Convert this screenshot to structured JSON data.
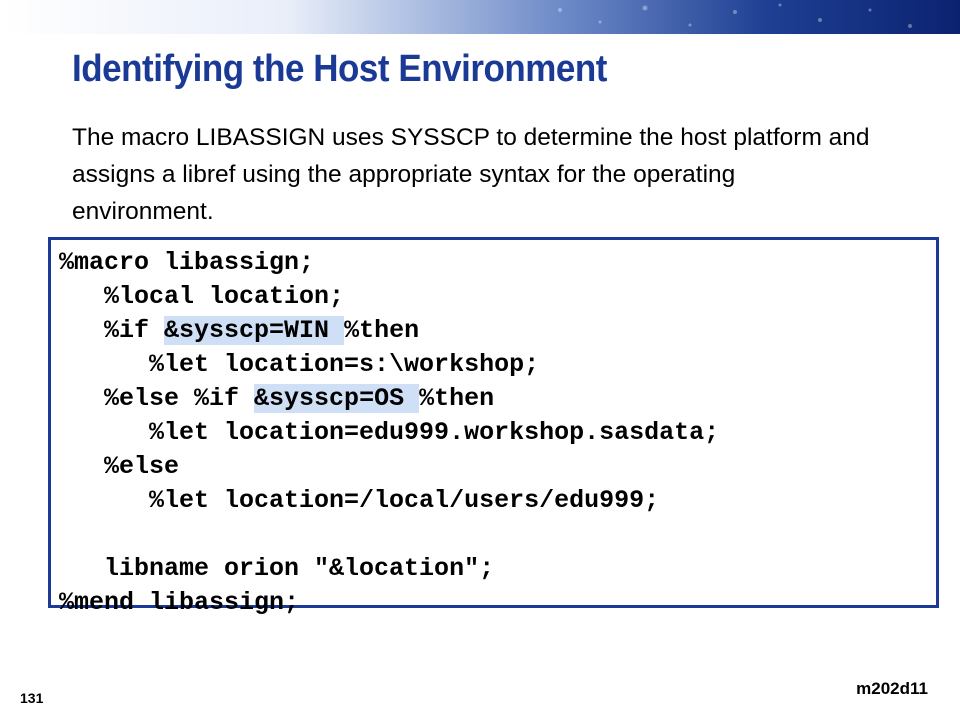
{
  "slide": {
    "title": "Identifying the Host Environment",
    "intro": "The macro LIBASSIGN uses SYSSCP to determine the host platform and assigns a libref using the appropriate syntax for the operating environment.",
    "slide_number": "131",
    "program_id": "m202d11",
    "accent_color": "#1a3a96"
  },
  "code": {
    "highlight_color": "#cfe0f6",
    "lines": [
      {
        "pre": "%macro libassign;",
        "hl": "",
        "post": ""
      },
      {
        "pre": "   %local location;",
        "hl": "",
        "post": ""
      },
      {
        "pre": "   %if ",
        "hl": "&sysscp=WIN ",
        "post": "%then"
      },
      {
        "pre": "      %let location=s:\\workshop;",
        "hl": "",
        "post": ""
      },
      {
        "pre": "   %else %if ",
        "hl": "&sysscp=OS ",
        "post": "%then"
      },
      {
        "pre": "      %let location=edu999.workshop.sasdata;",
        "hl": "",
        "post": ""
      },
      {
        "pre": "   %else",
        "hl": "",
        "post": ""
      },
      {
        "pre": "      %let location=/local/users/edu999;",
        "hl": "",
        "post": ""
      },
      {
        "pre": "",
        "hl": "",
        "post": ""
      },
      {
        "pre": "   libname orion \"&location\";",
        "hl": "",
        "post": ""
      },
      {
        "pre": "%mend libassign;",
        "hl": "",
        "post": ""
      }
    ]
  }
}
